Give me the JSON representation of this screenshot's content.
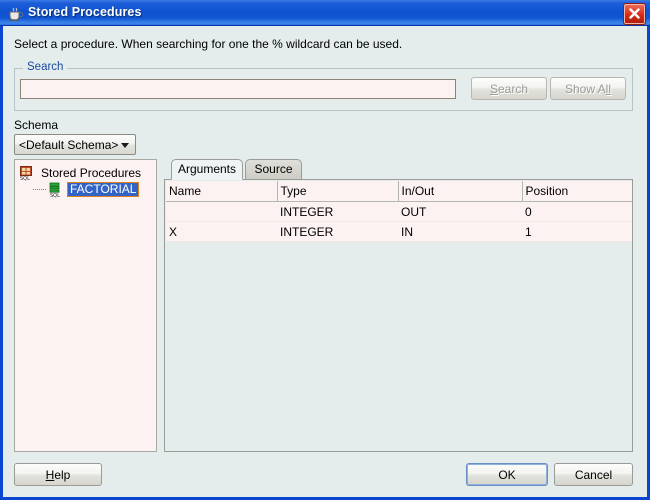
{
  "window": {
    "title": "Stored Procedures",
    "title_icon": "coffee-cup-icon",
    "close_label": "✕"
  },
  "instruction": "Select a procedure. When searching for one the % wildcard can be used.",
  "search": {
    "legend": "Search",
    "input_value": "",
    "input_placeholder": "",
    "search_button": "Search",
    "search_button_prefix": "S",
    "search_button_suffix": "earch",
    "show_all_button": "Show All",
    "show_all_prefix": "Show A",
    "show_all_suffix": "ll",
    "disabled": true
  },
  "schema": {
    "label": "Schema",
    "selected": "<Default Schema>",
    "options": [
      "<Default Schema>"
    ]
  },
  "tree": {
    "root_label": "Stored Procedures",
    "root_icon": "database-procedures-icon",
    "child_label": "FACTORIAL",
    "child_icon": "sql-procedure-icon",
    "child_selected": true
  },
  "tabs": [
    {
      "label": "Arguments",
      "selected": true
    },
    {
      "label": "Source",
      "selected": false
    }
  ],
  "table": {
    "columns": [
      "Name",
      "Type",
      "In/Out",
      "Position"
    ],
    "rows": [
      {
        "name": "",
        "type": "INTEGER",
        "inout": "OUT",
        "position": "0"
      },
      {
        "name": "X",
        "type": "INTEGER",
        "inout": "IN",
        "position": "1"
      }
    ]
  },
  "footer": {
    "help": "Help",
    "help_prefix": "H",
    "help_suffix": "elp",
    "ok": "OK",
    "cancel": "Cancel"
  },
  "colors": {
    "titlebar_blue": "#0f52d0",
    "dialog_bg": "#e4ecec",
    "field_bg": "#fdf2f2",
    "selection_blue": "#3264c8",
    "selection_border": "#e08018",
    "legend_text": "#1c4a9e",
    "close_red": "#d62b14"
  }
}
